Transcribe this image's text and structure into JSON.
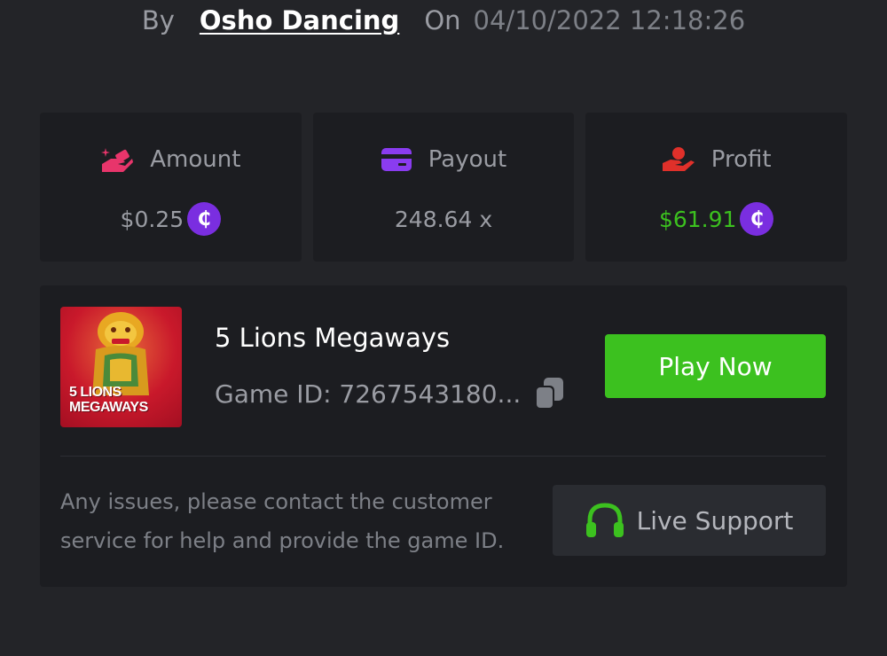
{
  "bet_meta": {
    "by_label": "By",
    "username": "Osho Dancing",
    "on_label": "On",
    "datetime": "04/10/2022 12:18:26"
  },
  "stats": [
    {
      "label": "Amount",
      "value": "$0.25",
      "icon": "money-hand-icon",
      "icon_color": "#e8356b",
      "has_coin": true,
      "value_color": "#9a9ca3"
    },
    {
      "label": "Payout",
      "value": "248.64 x",
      "icon": "card-icon",
      "icon_color": "#8a3cf0",
      "has_coin": false,
      "value_color": "#9a9ca3"
    },
    {
      "label": "Profit",
      "value": "$61.91",
      "icon": "hand-coin-icon",
      "icon_color": "#e0302a",
      "has_coin": true,
      "value_color": "#3cc11f"
    }
  ],
  "coin_symbol": "₵",
  "coin_color": "#7a2ee0",
  "game": {
    "title": "5 Lions Megaways",
    "thumbnail_text_line1": "5 LIONS",
    "thumbnail_text_line2": "MEGAWAYS",
    "game_id_label": "Game ID: 7267543180...",
    "copy_icon": "copy-icon",
    "play_button": "Play Now"
  },
  "support": {
    "help_text": "Any issues, please contact the customer service for help and provide the game ID.",
    "button_label": "Live Support",
    "icon": "headset-icon"
  },
  "colors": {
    "background": "#232428",
    "card": "#1c1d21",
    "accent_green": "#3cc11f"
  }
}
